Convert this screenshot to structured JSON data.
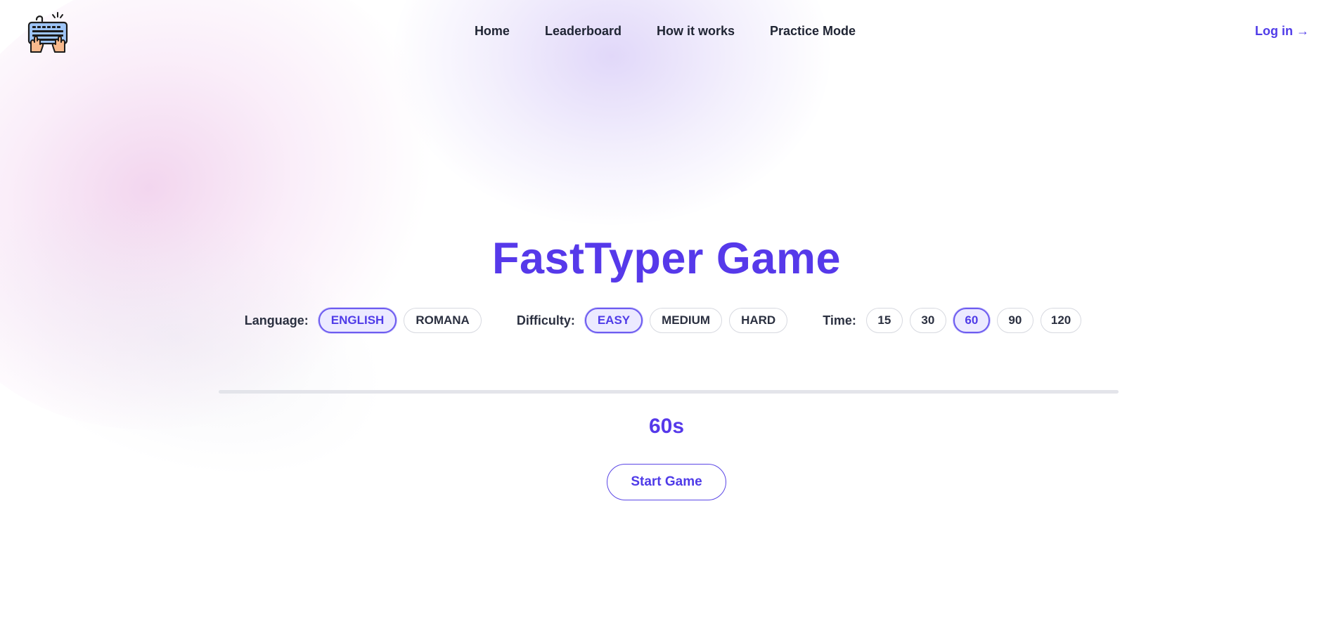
{
  "header": {
    "logo_icon": "keyboard-with-typing-hands-icon",
    "nav": [
      "Home",
      "Leaderboard",
      "How it works",
      "Practice Mode"
    ],
    "login_label": "Log in →"
  },
  "main": {
    "title": "FastTyper Game",
    "language": {
      "label": "Language:",
      "options": [
        "ENGLISH",
        "ROMANA"
      ],
      "selected": "ENGLISH"
    },
    "difficulty": {
      "label": "Difficulty:",
      "options": [
        "EASY",
        "MEDIUM",
        "HARD"
      ],
      "selected": "EASY"
    },
    "time": {
      "label": "Time:",
      "options": [
        "15",
        "30",
        "60",
        "90",
        "120"
      ],
      "selected": "60"
    },
    "progress": 0,
    "timer": "60s",
    "start_label": "Start Game"
  },
  "colors": {
    "accent": "#5639ea",
    "selected_bg": "#eceaff",
    "text": "#1f2433",
    "pill_border": "#d7d9e0"
  }
}
